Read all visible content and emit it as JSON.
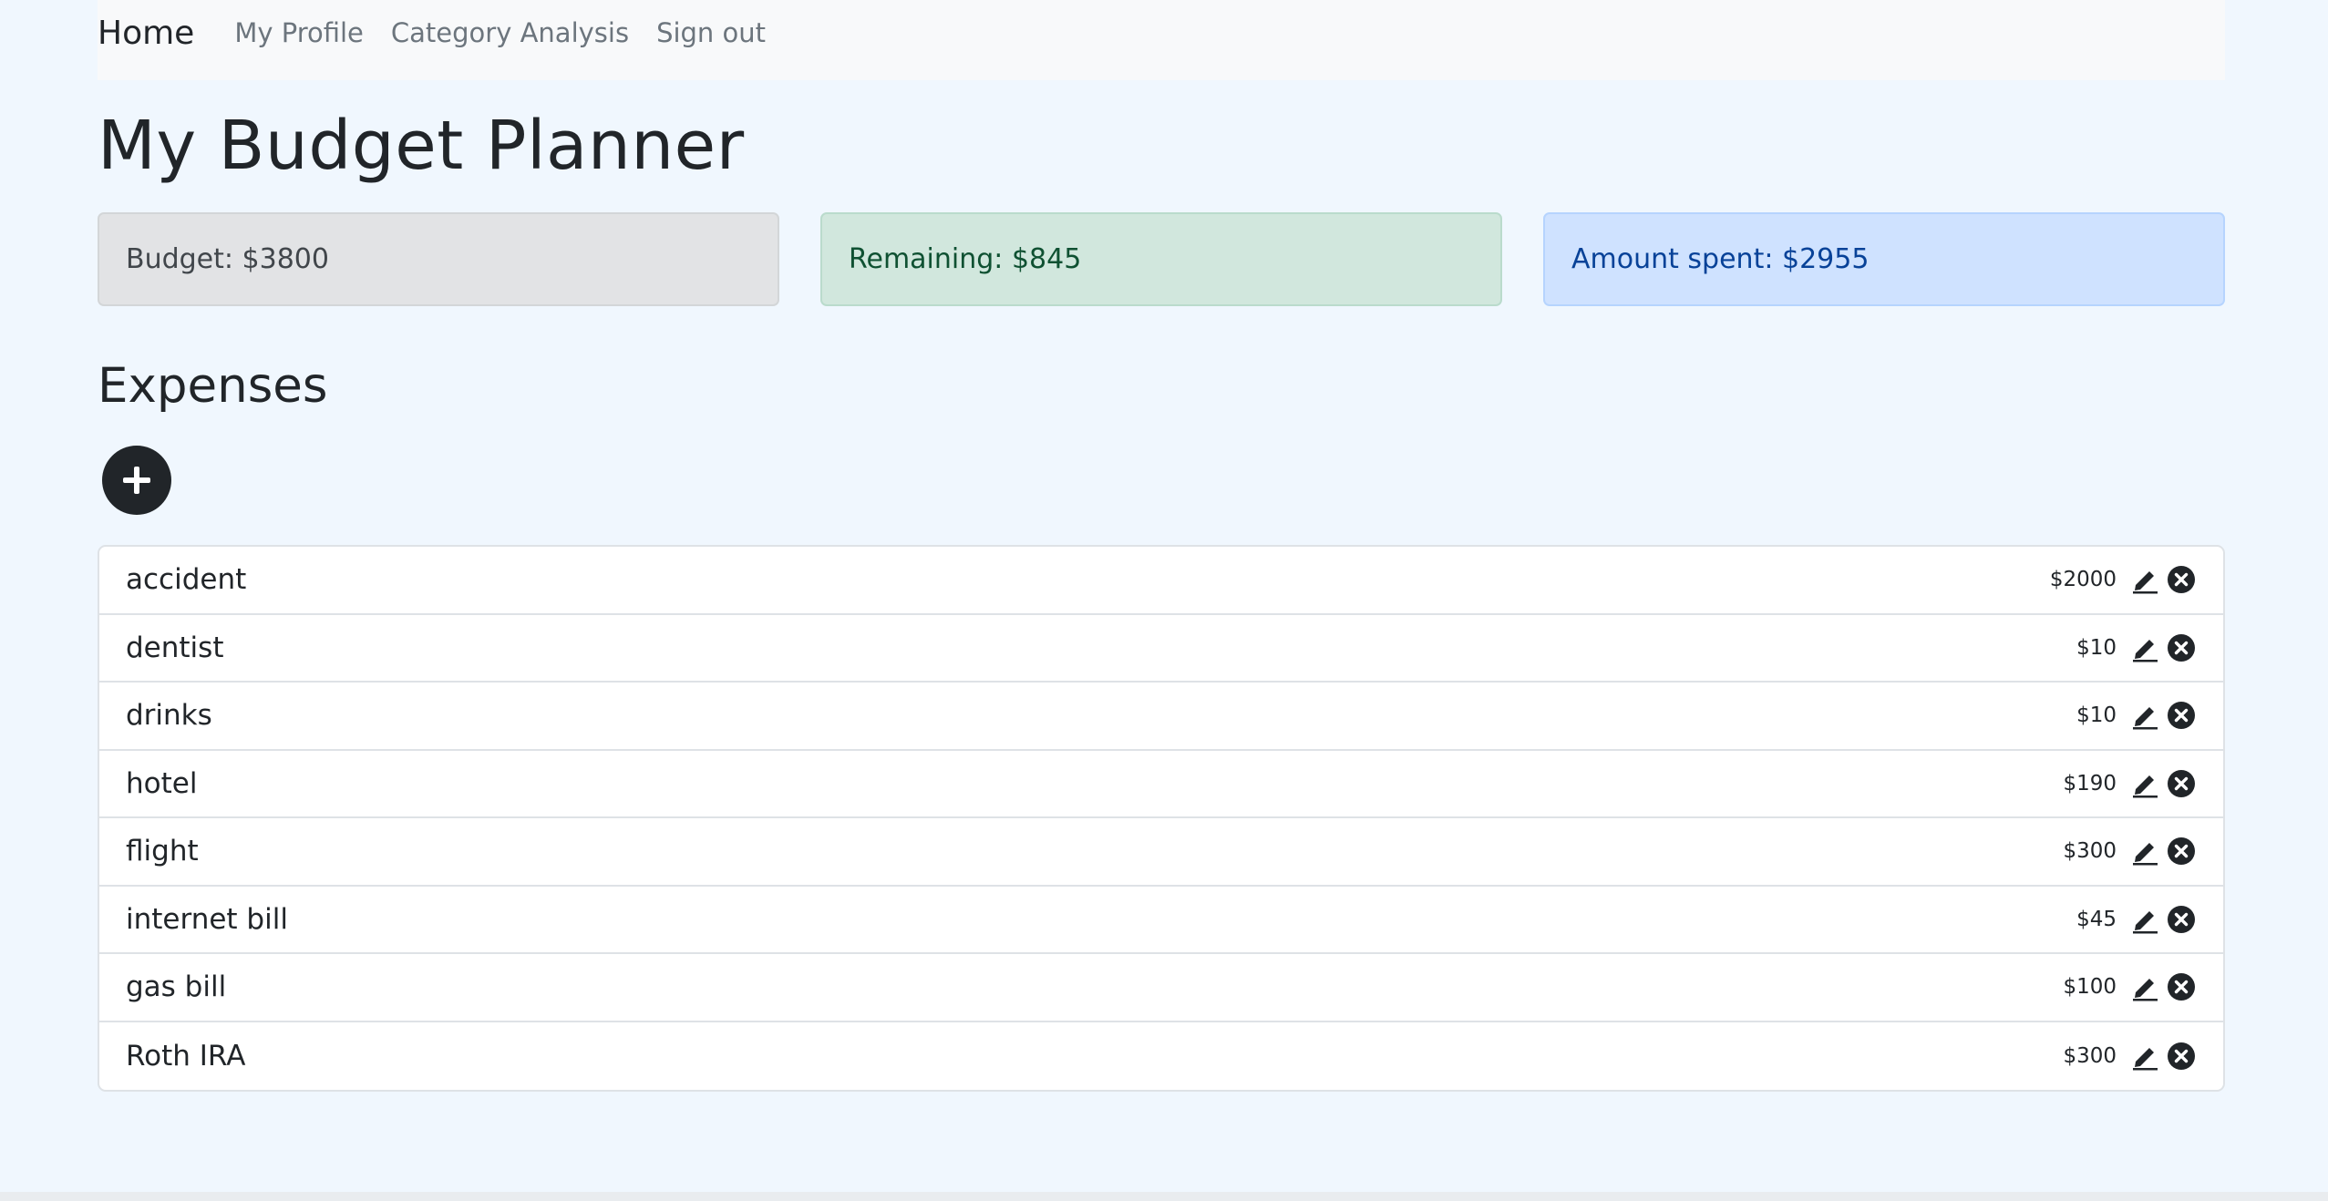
{
  "nav": {
    "brand": "Home",
    "links": [
      {
        "label": "My Profile"
      },
      {
        "label": "Category Analysis"
      },
      {
        "label": "Sign out"
      }
    ]
  },
  "page": {
    "title": "My Budget Planner"
  },
  "summary": {
    "budget": "Budget: $3800",
    "remaining": "Remaining: $845",
    "spent": "Amount spent: $2955",
    "colors": {
      "budget_bg": "#e2e3e5",
      "remaining_bg": "#d1e7dd",
      "spent_bg": "#cfe2ff"
    }
  },
  "expenses": {
    "heading": "Expenses",
    "add_icon": "plus-icon",
    "edit_icon": "pencil-icon",
    "delete_icon": "x-circle-icon",
    "items": [
      {
        "name": "accident",
        "amount": "$2000"
      },
      {
        "name": "dentist",
        "amount": "$10"
      },
      {
        "name": "drinks",
        "amount": "$10"
      },
      {
        "name": "hotel",
        "amount": "$190"
      },
      {
        "name": "flight",
        "amount": "$300"
      },
      {
        "name": "internet bill",
        "amount": "$45"
      },
      {
        "name": "gas bill",
        "amount": "$100"
      },
      {
        "name": "Roth IRA",
        "amount": "$300"
      }
    ]
  }
}
